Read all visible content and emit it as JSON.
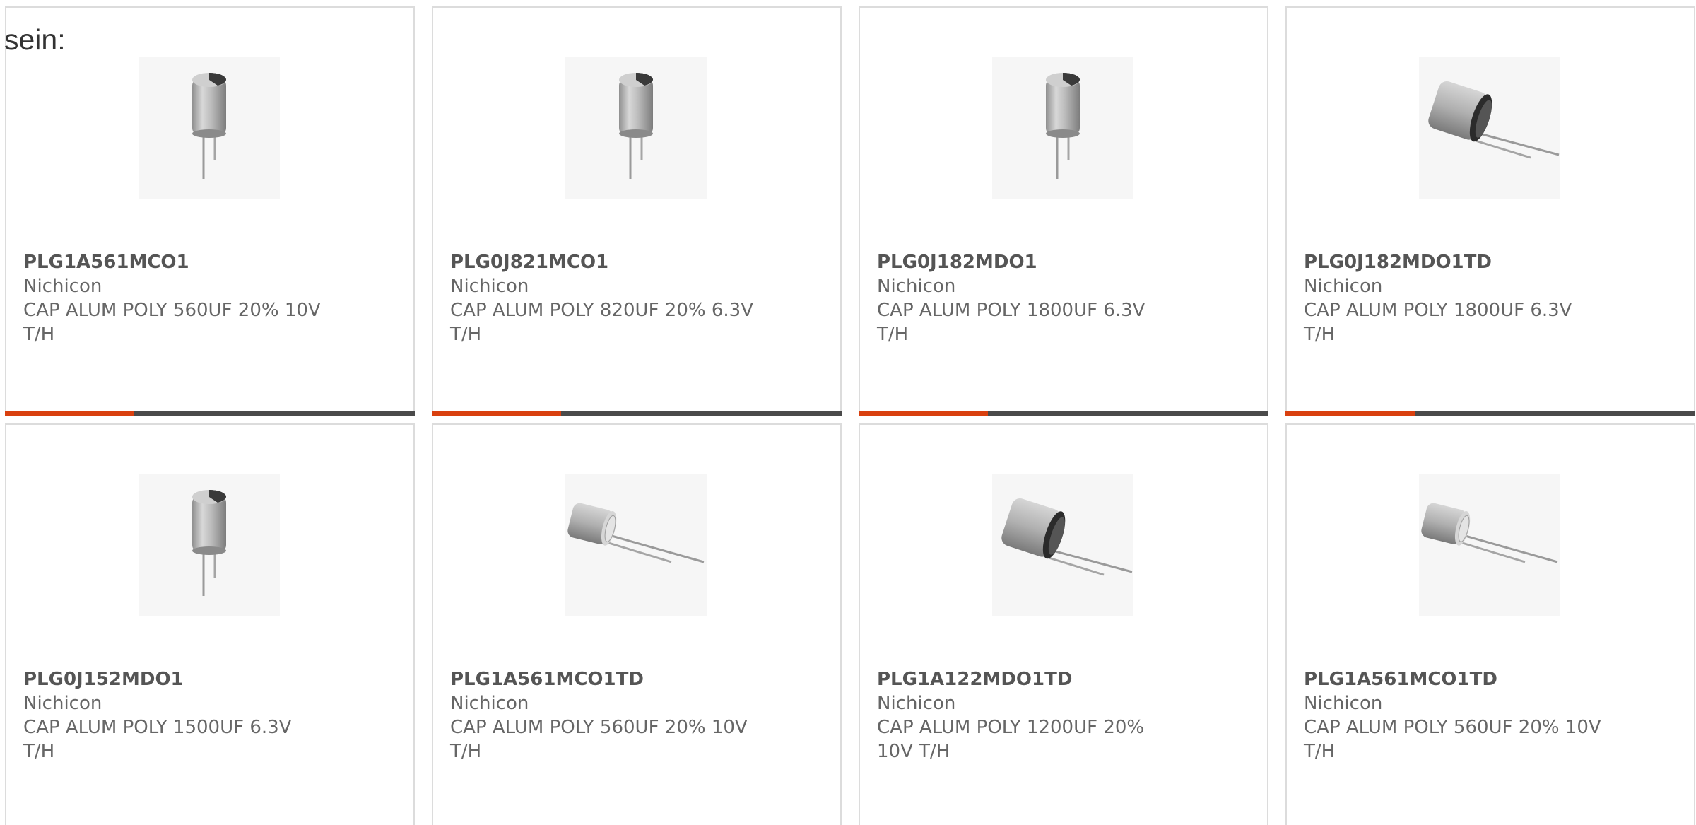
{
  "intro_text": "sein:",
  "accent_color": "#d9400f",
  "bar_color": "#4a4a4a",
  "products": [
    {
      "part_number": "PLG1A561MCO1",
      "manufacturer": "Nichicon",
      "description": "CAP ALUM POLY 560UF 20% 10V T/H",
      "image": "capacitor-upright-image"
    },
    {
      "part_number": "PLG0J821MCO1",
      "manufacturer": "Nichicon",
      "description": "CAP ALUM POLY 820UF 20% 6.3V T/H",
      "image": "capacitor-upright-image"
    },
    {
      "part_number": "PLG0J182MDO1",
      "manufacturer": "Nichicon",
      "description": "CAP ALUM POLY 1800UF 6.3V T/H",
      "image": "capacitor-upright-image"
    },
    {
      "part_number": "PLG0J182MDO1TD",
      "manufacturer": "Nichicon",
      "description": "CAP ALUM POLY 1800UF 6.3V T/H",
      "image": "capacitor-tilted-image"
    },
    {
      "part_number": "PLG0J152MDO1",
      "manufacturer": "Nichicon",
      "description": "CAP ALUM POLY 1500UF 6.3V T/H",
      "image": "capacitor-upright-image"
    },
    {
      "part_number": "PLG1A561MCO1TD",
      "manufacturer": "Nichicon",
      "description": "CAP ALUM POLY 560UF 20% 10V T/H",
      "image": "capacitor-tilted-small-image"
    },
    {
      "part_number": "PLG1A122MDO1TD",
      "manufacturer": "Nichicon",
      "description": "CAP ALUM POLY 1200UF 20% 10V T/H",
      "image": "capacitor-tilted-image"
    },
    {
      "part_number": "PLG1A561MCO1TD",
      "manufacturer": "Nichicon",
      "description": "CAP ALUM POLY 560UF 20% 10V T/H",
      "image": "capacitor-tilted-small-image"
    }
  ]
}
